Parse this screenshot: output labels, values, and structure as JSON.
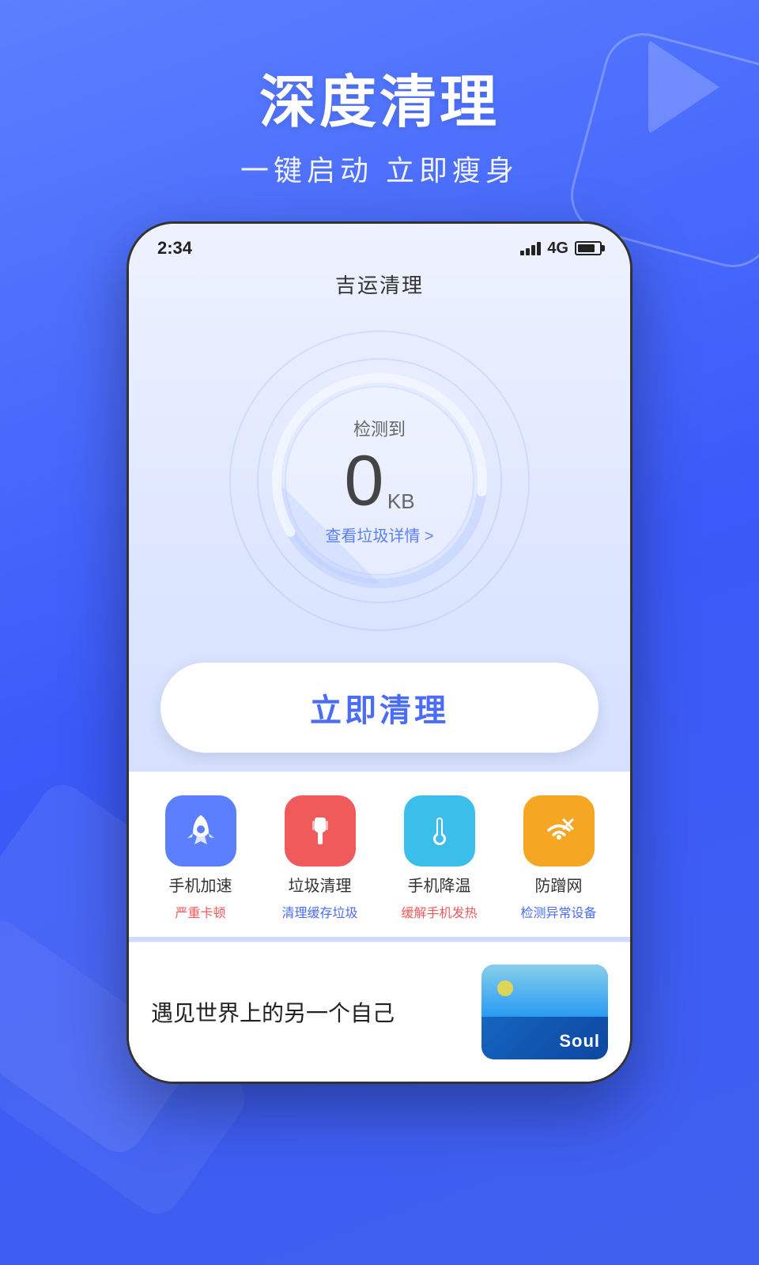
{
  "page": {
    "background_color": "#4a6cf7"
  },
  "header": {
    "main_title": "深度清理",
    "sub_title": "一键启动 立即瘦身"
  },
  "status_bar": {
    "time": "2:34",
    "network": "4G"
  },
  "app_header": {
    "title": "吉运清理"
  },
  "gauge": {
    "label": "检测到",
    "value": "0",
    "unit": "KB",
    "detail_link": "查看垃圾详情 >"
  },
  "clean_button": {
    "label": "立即清理"
  },
  "features": [
    {
      "id": "speed",
      "name": "手机加速",
      "status": "严重卡顿",
      "status_color": "red",
      "icon_color": "blue",
      "icon_type": "rocket"
    },
    {
      "id": "trash",
      "name": "垃圾清理",
      "status": "清理缓存垃圾",
      "status_color": "blue",
      "icon_color": "red",
      "icon_type": "brush"
    },
    {
      "id": "cool",
      "name": "手机降温",
      "status": "缓解手机发热",
      "status_color": "red",
      "icon_color": "cyan",
      "icon_type": "thermometer"
    },
    {
      "id": "wifi",
      "name": "防蹭网",
      "status": "检测异常设备",
      "status_color": "none",
      "icon_color": "orange",
      "icon_type": "wifi-x"
    }
  ],
  "ad_banner": {
    "text": "遇见世界上的另一个自己",
    "app_name": "Soul"
  }
}
